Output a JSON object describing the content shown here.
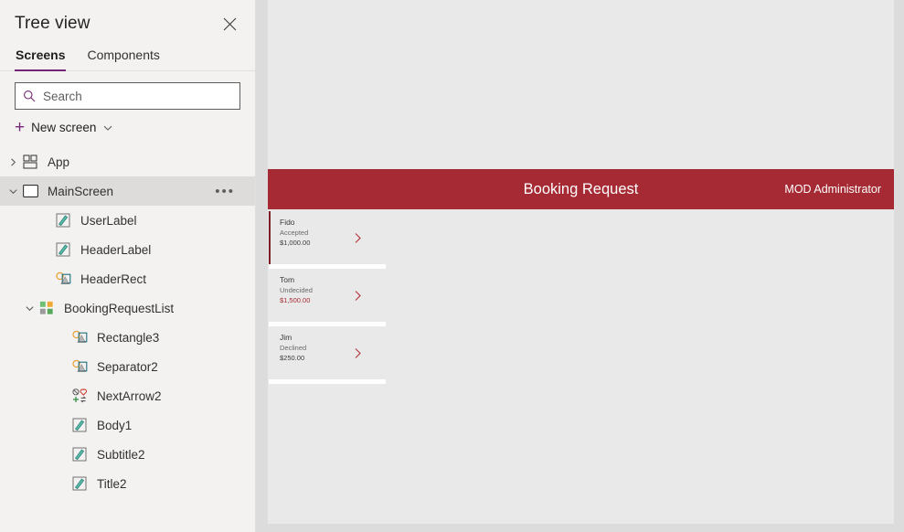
{
  "panel": {
    "title": "Tree view",
    "close_icon": "close-icon",
    "tabs": [
      {
        "label": "Screens",
        "active": true
      },
      {
        "label": "Components",
        "active": false
      }
    ],
    "search": {
      "placeholder": "Search",
      "value": "",
      "icon": "search-icon"
    },
    "new_screen": {
      "label": "New screen",
      "plus_icon": "plus-icon",
      "chevron_icon": "chevron-down-icon"
    },
    "accent_color": "#742774",
    "selected_row_color": "#dedcdb",
    "tree": [
      {
        "label": "App",
        "icon": "app-grid-icon",
        "indent": 0,
        "toggle": "collapsed",
        "selected": false,
        "more": false
      },
      {
        "label": "MainScreen",
        "icon": "screen-icon",
        "indent": 0,
        "toggle": "expanded",
        "selected": true,
        "more": true,
        "more_label": "•••"
      },
      {
        "label": "UserLabel",
        "icon": "label-icon",
        "indent": 2,
        "toggle": "none",
        "selected": false,
        "more": false
      },
      {
        "label": "HeaderLabel",
        "icon": "label-icon",
        "indent": 2,
        "toggle": "none",
        "selected": false,
        "more": false
      },
      {
        "label": "HeaderRect",
        "icon": "shape-icon",
        "indent": 2,
        "toggle": "none",
        "selected": false,
        "more": false
      },
      {
        "label": "BookingRequestList",
        "icon": "gallery-icon",
        "indent": 1,
        "toggle": "expanded",
        "selected": false,
        "more": false
      },
      {
        "label": "Rectangle3",
        "icon": "shape-icon",
        "indent": 3,
        "toggle": "none",
        "selected": false,
        "more": false
      },
      {
        "label": "Separator2",
        "icon": "shape-icon",
        "indent": 3,
        "toggle": "none",
        "selected": false,
        "more": false
      },
      {
        "label": "NextArrow2",
        "icon": "next-arrow-icon",
        "indent": 3,
        "toggle": "none",
        "selected": false,
        "more": false
      },
      {
        "label": "Body1",
        "icon": "label-icon",
        "indent": 3,
        "toggle": "none",
        "selected": false,
        "more": false
      },
      {
        "label": "Subtitle2",
        "icon": "label-icon",
        "indent": 3,
        "toggle": "none",
        "selected": false,
        "more": false
      },
      {
        "label": "Title2",
        "icon": "label-icon",
        "indent": 3,
        "toggle": "none",
        "selected": false,
        "more": false
      }
    ]
  },
  "canvas": {
    "background": "#e9e9e9",
    "header": {
      "title": "Booking Request",
      "user": "MOD Administrator",
      "background": "#a52a33",
      "text_color": "#ffffff"
    },
    "gallery": {
      "items": [
        {
          "title": "Fido",
          "subtitle": "Accepted",
          "body": "$1,000.00",
          "selected": true,
          "body_accent": false,
          "arrow_icon": "chevron-right-icon"
        },
        {
          "title": "Tom",
          "subtitle": "Undecided",
          "body": "$1,500.00",
          "selected": false,
          "body_accent": true,
          "arrow_icon": "chevron-right-icon"
        },
        {
          "title": "Jim",
          "subtitle": "Declined",
          "body": "$250.00",
          "selected": false,
          "body_accent": false,
          "arrow_icon": "chevron-right-icon"
        }
      ]
    }
  }
}
